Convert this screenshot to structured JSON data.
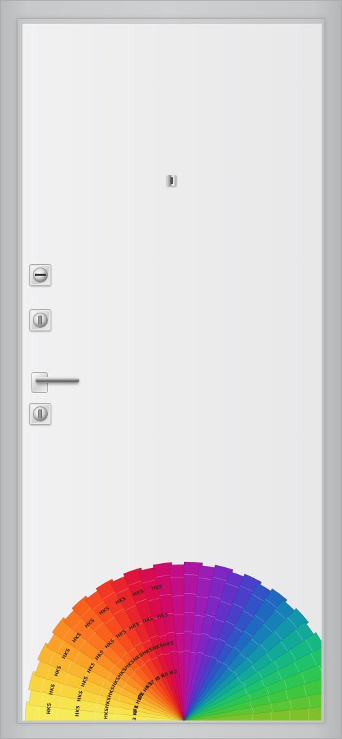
{
  "scene": {
    "subject": "door",
    "frame_color": "#c9cacb",
    "leaf_color": "#ececed"
  },
  "hardware": [
    {
      "name": "upper-lock-cylinder",
      "kind": "cylinder"
    },
    {
      "name": "middle-lock-cylinder",
      "kind": "cylinder"
    },
    {
      "name": "handle",
      "kind": "lever"
    },
    {
      "name": "lower-lock-cylinder",
      "kind": "cylinder"
    }
  ],
  "fan_deck": {
    "brand_text": "HKS",
    "strip_labels": [
      "3 K",
      "4 K",
      "41 HKS",
      "5 K",
      "51 HKS",
      "6 K",
      "7 K",
      "8 K",
      "10 K",
      "12"
    ],
    "colors": [
      "#f6ea58",
      "#f7e34d",
      "#f8d43e",
      "#f9c535",
      "#fab52e",
      "#fba127",
      "#fb8c21",
      "#fb761e",
      "#fa611d",
      "#f84c1f",
      "#f23824",
      "#e9242c",
      "#e01438",
      "#d80c4e",
      "#ce0b69",
      "#c30e86",
      "#b015a1",
      "#9a1db6",
      "#7f27c2",
      "#6431c8",
      "#4a3fc9",
      "#3153c6",
      "#1f69c0",
      "#1680b7",
      "#1296aa",
      "#12a998",
      "#16b782",
      "#1fc16a",
      "#2cc654",
      "#3fc63f",
      "#5cc533",
      "#7ec22b"
    ]
  }
}
